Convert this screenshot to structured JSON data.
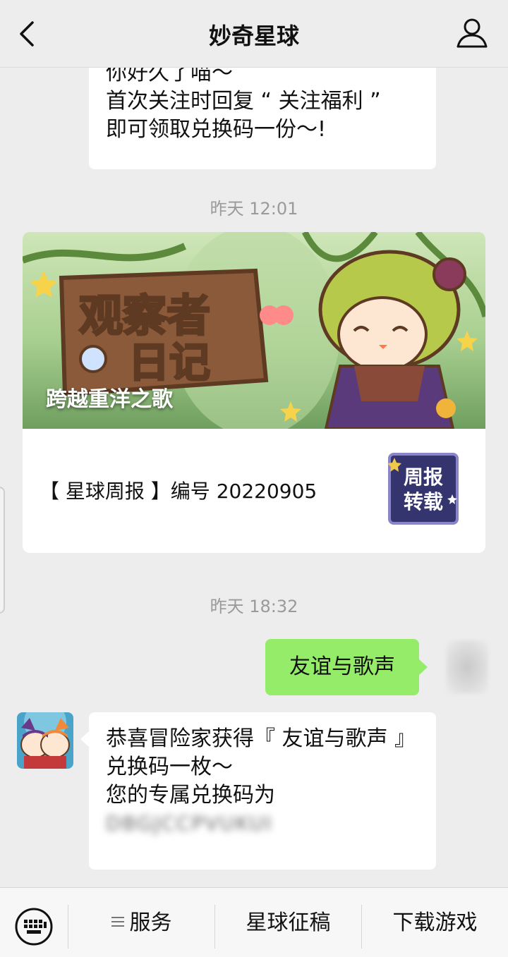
{
  "header": {
    "title": "妙奇星球",
    "back_icon": "chevron-left-icon",
    "profile_icon": "person-icon"
  },
  "messages": {
    "first": {
      "lines": [
        "你好久了喵～",
        "首次关注时回复 “ 关注福利 ”",
        "即可领取兑换码一份～!"
      ]
    },
    "timestamp_1": "昨天 12:01",
    "article": {
      "cover_title": "跨越重洋之歌",
      "cover_logo_text": "观察者日记",
      "description": "【 星球周报 】编号 20220905",
      "thumb_text_line1": "周报",
      "thumb_text_line2": "转载"
    },
    "timestamp_2": "昨天 18:32",
    "outgoing": {
      "text": "友谊与歌声"
    },
    "reply": {
      "lines": [
        "恭喜冒险家获得『 友谊与歌声 』",
        "兑换码一枚～",
        "您的专属兑换码为"
      ],
      "code": "DBGJCCPVUKUI"
    }
  },
  "bottom_menu": {
    "keyboard_icon": "keyboard-icon",
    "items": [
      {
        "label": "服务",
        "icon": "menu-lines-icon"
      },
      {
        "label": "星球征稿"
      },
      {
        "label": "下载游戏"
      }
    ]
  },
  "colors": {
    "background": "#ededed",
    "outgoing_bubble": "#95ec69",
    "incoming_bubble": "#ffffff"
  }
}
